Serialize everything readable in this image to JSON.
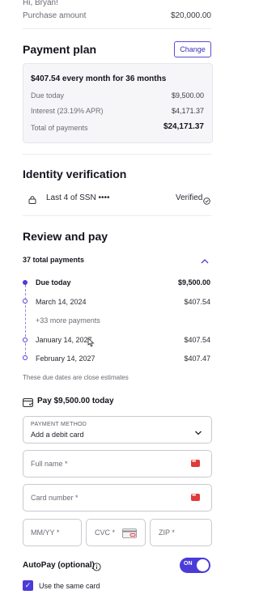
{
  "greeting": "Hi, Bryan!",
  "purchase": {
    "label": "Purchase amount",
    "value": "$20,000.00"
  },
  "payment_plan": {
    "title": "Payment plan",
    "change_label": "Change",
    "headline": "$407.54 every month for 36 months",
    "rows": [
      {
        "label": "Due today",
        "value": "$9,500.00"
      },
      {
        "label": "Interest (23.19% APR)",
        "value": "$4,171.37"
      },
      {
        "label": "Total of payments",
        "value": "$24,171.37"
      }
    ]
  },
  "identity": {
    "title": "Identity verification",
    "item_label": "Last 4 of SSN ••••",
    "status": "Verified"
  },
  "review": {
    "title": "Review and pay",
    "total_payments": "37 total payments",
    "schedule": [
      {
        "label": "Due today",
        "value": "$9,500.00"
      },
      {
        "label": "March 14, 2024",
        "value": "$407.54"
      },
      {
        "label": "+33 more payments",
        "value": ""
      },
      {
        "label": "January 14, 2027",
        "value": "$407.54"
      },
      {
        "label": "February 14, 2027",
        "value": "$407.47"
      }
    ],
    "estimate_note": "These due dates are close estimates",
    "pay_today": "Pay $9,500.00 today"
  },
  "form": {
    "payment_method_label": "PAYMENT METHOD",
    "payment_method_value": "Add a debit card",
    "full_name_placeholder": "Full name *",
    "card_number_placeholder": "Card number *",
    "expiry_placeholder": "MM/YY *",
    "cvc_placeholder": "CVC *",
    "zip_placeholder": "ZIP *"
  },
  "autopay": {
    "label": "AutoPay (optional)",
    "toggle_label": "ON",
    "enabled": true
  },
  "same_card": {
    "label": "Use the same card",
    "checked": true
  },
  "colors": {
    "accent": "#4b3bd8",
    "text": "#1e1e2a",
    "muted": "#6b6b76",
    "card_icon": "#e03a3a"
  }
}
